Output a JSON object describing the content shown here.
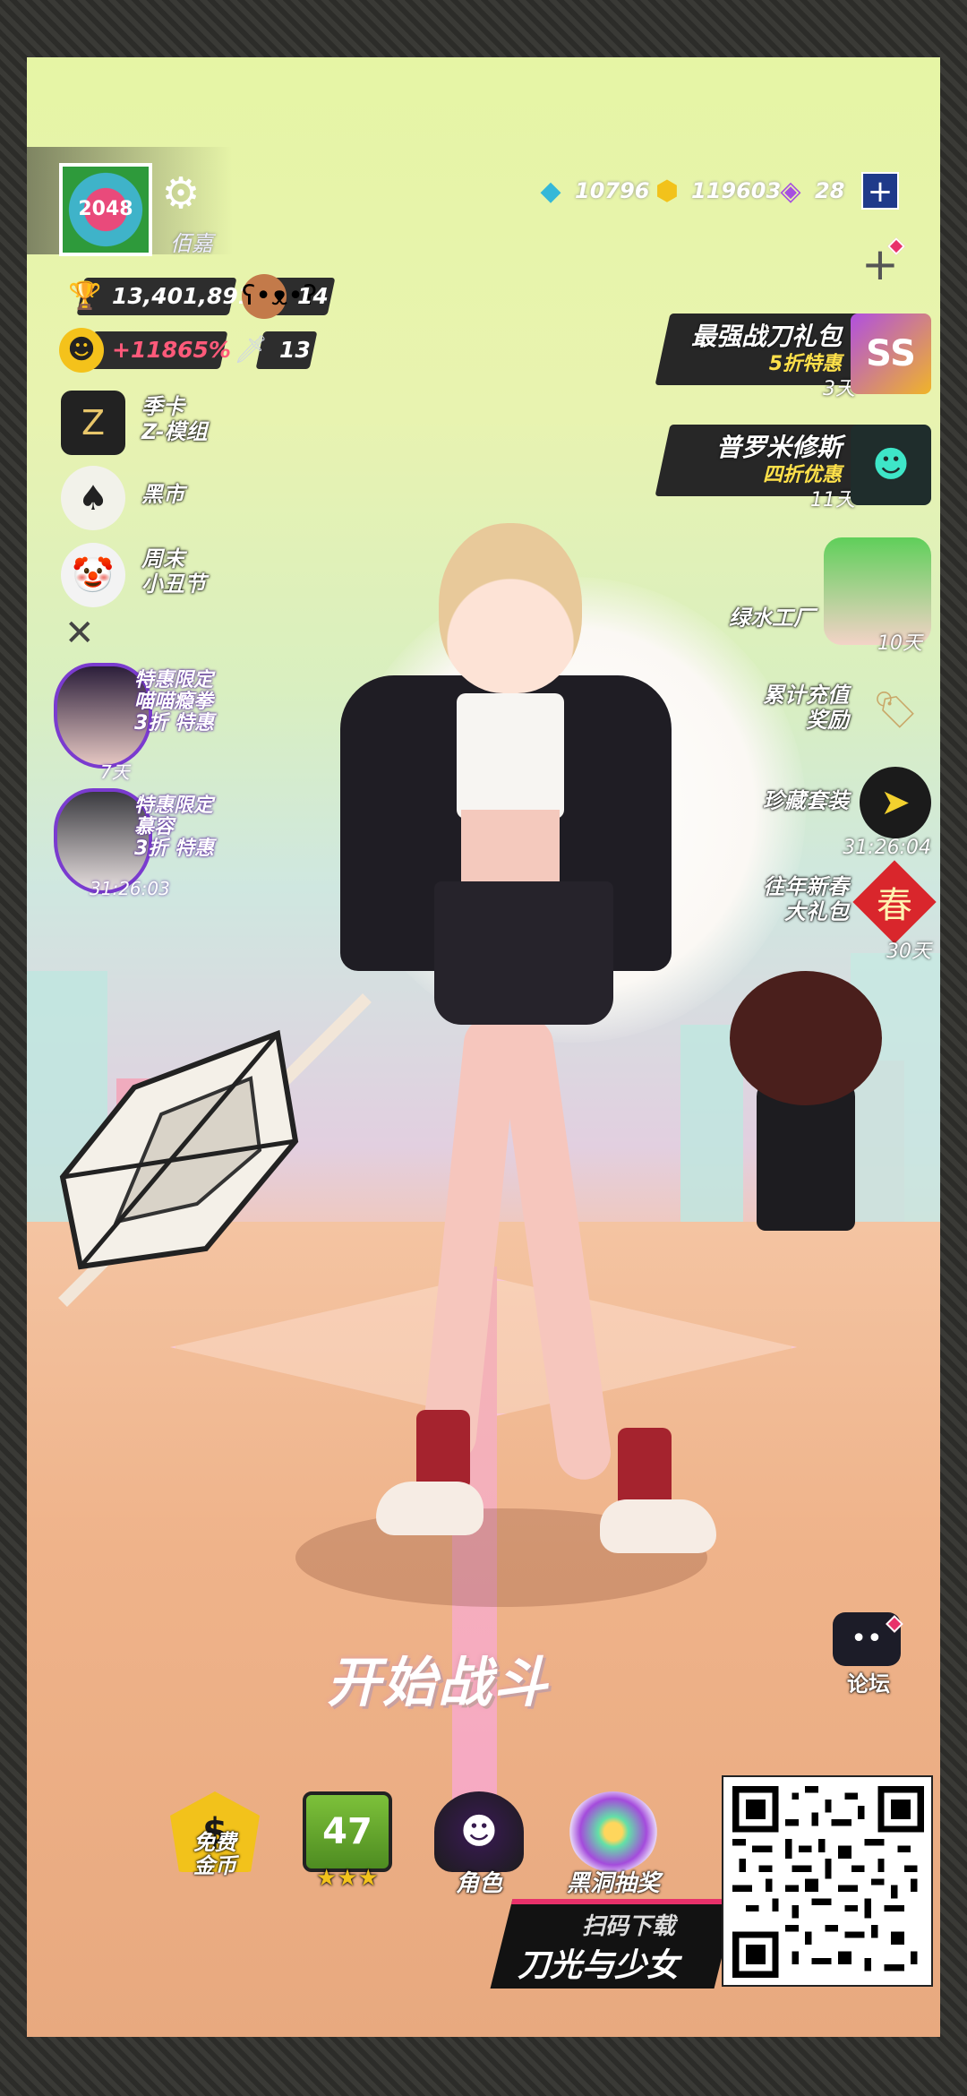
{
  "player": {
    "nickname": "佰嘉",
    "avatar_text": "2048",
    "trophy_score": "13,401,891",
    "bear_count": "14",
    "bonus_percent": "+11865%",
    "sword_count": "13"
  },
  "currencies": [
    {
      "icon": "diamond-icon",
      "value": "10796",
      "color": "#35b8d8"
    },
    {
      "icon": "gold-coin-icon",
      "value": "119603",
      "color": "#f2c21b"
    },
    {
      "icon": "purple-gem-icon",
      "value": "28",
      "color": "#a64fe0"
    }
  ],
  "left_menu": [
    {
      "label_line1": "季卡",
      "label_line2": "Z-模组",
      "icon": "z-module-icon"
    },
    {
      "label_line1": "黑市",
      "label_line2": "",
      "icon": "spade-icon"
    },
    {
      "label_line1": "周末",
      "label_line2": "小丑节",
      "icon": "clown-icon"
    }
  ],
  "left_promos": [
    {
      "tag_line1": "特惠限定",
      "tag_line2": "喵喵瘾拳",
      "tag_line3": "3折 特惠",
      "timer": "7天"
    },
    {
      "tag_line1": "特惠限定",
      "tag_line2": "慕容",
      "tag_line3": "3折 特惠",
      "timer": "31:26:03"
    }
  ],
  "right_banners": [
    {
      "title": "最强战刀礼包",
      "subtitle": "5折特惠",
      "days": "3天",
      "icon_text": "SS",
      "icon": "ss-gift-icon"
    },
    {
      "title": "普罗米修斯",
      "subtitle": "四折优惠",
      "days": "11天",
      "icon_text": "",
      "icon": "prometheus-mask-icon"
    }
  ],
  "right_menu": [
    {
      "label_line1": "绿水工厂",
      "label_line2": "",
      "timer": "10天",
      "icon": "green-hair-girl-icon"
    },
    {
      "label_line1": "累计充值",
      "label_line2": "奖励",
      "timer": "",
      "icon": "sale-tag-icon"
    },
    {
      "label_line1": "珍藏套装",
      "label_line2": "",
      "timer": "31:26:04",
      "icon": "paper-plane-icon"
    },
    {
      "label_line1": "往年新春",
      "label_line2": "大礼包",
      "timer": "30天",
      "icon": "spring-icon",
      "icon_text": "春"
    }
  ],
  "main": {
    "start_battle": "开始战斗",
    "forum": "论坛"
  },
  "dock": [
    {
      "label": "免费\n金币",
      "icon": "free-coin-icon",
      "badge": ""
    },
    {
      "label": "",
      "icon": "level-badge-icon",
      "badge": "47"
    },
    {
      "label": "角色",
      "icon": "character-icon",
      "badge": ""
    },
    {
      "label": "黑洞抽奖",
      "icon": "black-hole-icon",
      "badge": ""
    }
  ],
  "download": {
    "top": "扫码下载",
    "title": "刀光与少女"
  },
  "colors": {
    "accent_pink": "#e8316a",
    "gold": "#ffe14a",
    "dark_panel": "#272727"
  }
}
